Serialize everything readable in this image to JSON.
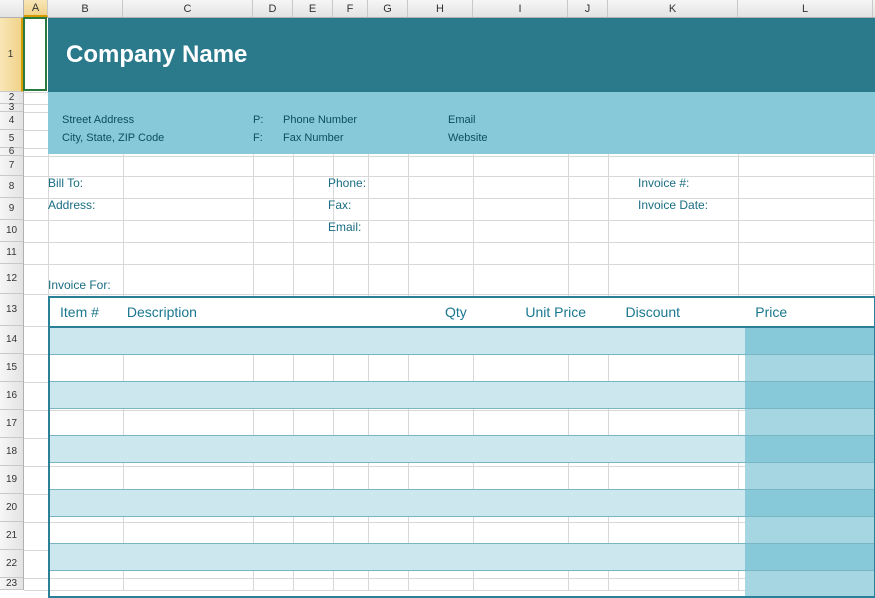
{
  "columns": [
    {
      "letter": "A",
      "width": 24
    },
    {
      "letter": "B",
      "width": 75
    },
    {
      "letter": "C",
      "width": 130
    },
    {
      "letter": "D",
      "width": 40
    },
    {
      "letter": "E",
      "width": 40
    },
    {
      "letter": "F",
      "width": 35
    },
    {
      "letter": "G",
      "width": 40
    },
    {
      "letter": "H",
      "width": 65
    },
    {
      "letter": "I",
      "width": 95
    },
    {
      "letter": "J",
      "width": 40
    },
    {
      "letter": "K",
      "width": 130
    },
    {
      "letter": "L",
      "width": 135
    }
  ],
  "rows": [
    {
      "n": 1,
      "h": 74
    },
    {
      "n": 2,
      "h": 12
    },
    {
      "n": 3,
      "h": 8
    },
    {
      "n": 4,
      "h": 18
    },
    {
      "n": 5,
      "h": 18
    },
    {
      "n": 6,
      "h": 8
    },
    {
      "n": 7,
      "h": 20
    },
    {
      "n": 8,
      "h": 22
    },
    {
      "n": 9,
      "h": 22
    },
    {
      "n": 10,
      "h": 22
    },
    {
      "n": 11,
      "h": 22
    },
    {
      "n": 12,
      "h": 30
    },
    {
      "n": 13,
      "h": 32
    },
    {
      "n": 14,
      "h": 28
    },
    {
      "n": 15,
      "h": 28
    },
    {
      "n": 16,
      "h": 28
    },
    {
      "n": 17,
      "h": 28
    },
    {
      "n": 18,
      "h": 28
    },
    {
      "n": 19,
      "h": 28
    },
    {
      "n": 20,
      "h": 28
    },
    {
      "n": 21,
      "h": 28
    },
    {
      "n": 22,
      "h": 28
    },
    {
      "n": 23,
      "h": 12
    }
  ],
  "selected": {
    "col": "A",
    "row": 1
  },
  "header": {
    "company_name": "Company Name"
  },
  "company_info": {
    "street": "Street Address",
    "city": "City, State, ZIP Code",
    "p_label": "P:",
    "phone": "Phone Number",
    "f_label": "F:",
    "fax": "Fax Number",
    "email": "Email",
    "website": "Website"
  },
  "billing": {
    "bill_to_label": "Bill To:",
    "address_label": "Address:",
    "phone_label": "Phone:",
    "fax_label": "Fax:",
    "email_label": "Email:",
    "invoice_no_label": "Invoice #:",
    "invoice_date_label": "Invoice Date:"
  },
  "invoice_for_label": "Invoice For:",
  "table_headers": {
    "item": "Item #",
    "description": "Description",
    "qty": "Qty",
    "unit_price": "Unit Price",
    "discount": "Discount",
    "price": "Price"
  },
  "table_rows": [
    {
      "item": "",
      "description": "",
      "qty": "",
      "unit_price": "",
      "discount": "",
      "price": ""
    },
    {
      "item": "",
      "description": "",
      "qty": "",
      "unit_price": "",
      "discount": "",
      "price": ""
    },
    {
      "item": "",
      "description": "",
      "qty": "",
      "unit_price": "",
      "discount": "",
      "price": ""
    },
    {
      "item": "",
      "description": "",
      "qty": "",
      "unit_price": "",
      "discount": "",
      "price": ""
    },
    {
      "item": "",
      "description": "",
      "qty": "",
      "unit_price": "",
      "discount": "",
      "price": ""
    },
    {
      "item": "",
      "description": "",
      "qty": "",
      "unit_price": "",
      "discount": "",
      "price": ""
    },
    {
      "item": "",
      "description": "",
      "qty": "",
      "unit_price": "",
      "discount": "",
      "price": ""
    },
    {
      "item": "",
      "description": "",
      "qty": "",
      "unit_price": "",
      "discount": "",
      "price": ""
    },
    {
      "item": "",
      "description": "",
      "qty": "",
      "unit_price": "",
      "discount": "",
      "price": ""
    },
    {
      "item": "",
      "description": "",
      "qty": "",
      "unit_price": "",
      "discount": "",
      "price": ""
    }
  ]
}
